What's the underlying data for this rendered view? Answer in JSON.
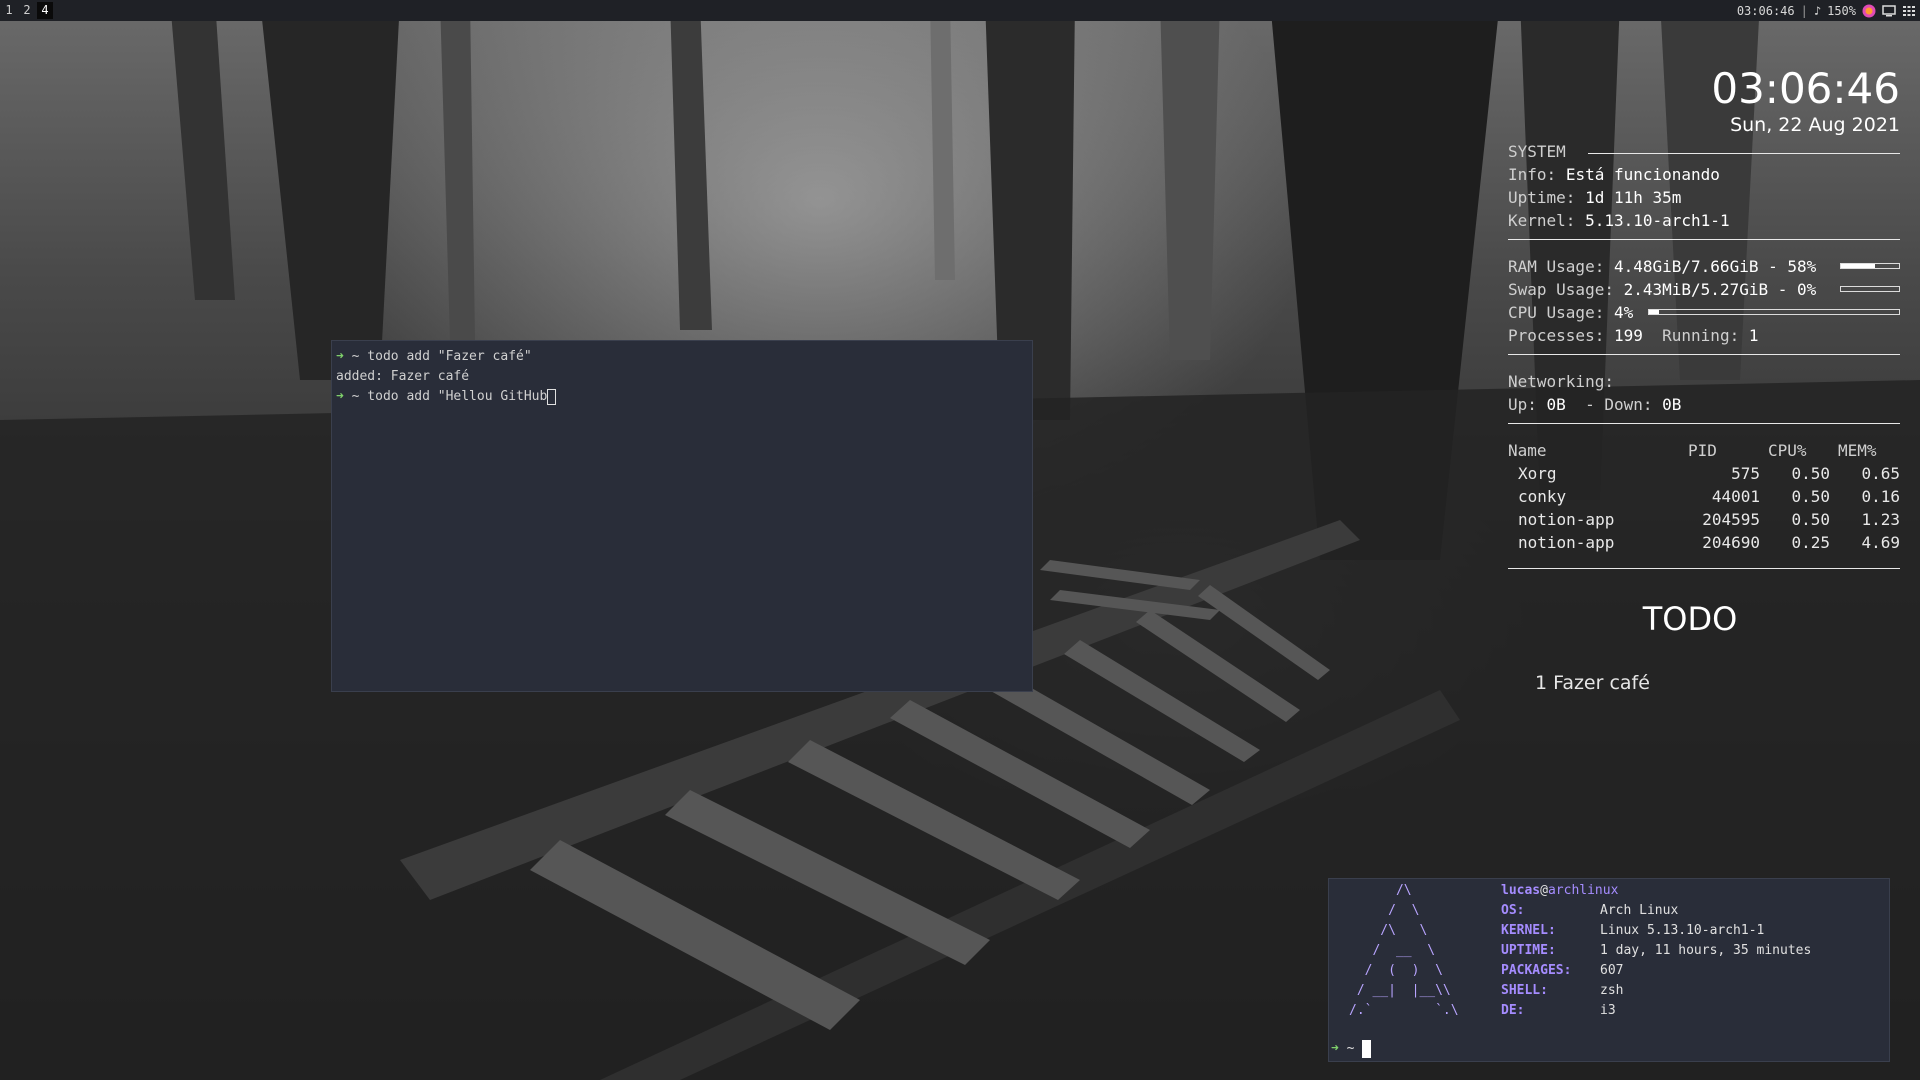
{
  "topbar": {
    "workspaces": [
      {
        "label": "1",
        "focused": false
      },
      {
        "label": "2",
        "focused": false
      },
      {
        "label": "4",
        "focused": true
      }
    ],
    "time": "03:06:46",
    "separator": "|",
    "volume": "150%",
    "icons": [
      "music-note-icon",
      "firefox-icon",
      "monitor-icon",
      "grid-icon"
    ]
  },
  "conky": {
    "clock": "03:06:46",
    "date": "Sun, 22 Aug 2021",
    "system_header": "SYSTEM",
    "info_label": "Info:",
    "info_value": "Está funcionando",
    "uptime_label": "Uptime:",
    "uptime_value": "1d 11h 35m",
    "kernel_label": "Kernel:",
    "kernel_value": "5.13.10-arch1-1",
    "ram_label": "RAM Usage:",
    "ram_value": "4.48GiB/7.66GiB - 58%",
    "ram_percent": 58,
    "swap_label": "Swap Usage:",
    "swap_value": "2.43MiB/5.27GiB - 0%",
    "swap_percent": 0,
    "cpu_label": "CPU Usage:",
    "cpu_value": "4%",
    "cpu_percent": 4,
    "processes_label": "Processes:",
    "processes_value": "199",
    "running_label": "Running:",
    "running_value": "1",
    "networking_label": "Networking:",
    "up_label": "Up:",
    "up_value": "0B",
    "down_label": "- Down:",
    "down_value": "0B",
    "proc_headers": {
      "name": "Name",
      "pid": "PID",
      "cpu": "CPU%",
      "mem": "MEM%"
    },
    "processes": [
      {
        "name": "Xorg",
        "pid": "575",
        "cpu": "0.50",
        "mem": "0.65"
      },
      {
        "name": "conky",
        "pid": "44001",
        "cpu": "0.50",
        "mem": "0.16"
      },
      {
        "name": "notion-app",
        "pid": "204595",
        "cpu": "0.50",
        "mem": "1.23"
      },
      {
        "name": "notion-app",
        "pid": "204690",
        "cpu": "0.25",
        "mem": "4.69"
      }
    ],
    "todo_title": "TODO",
    "todo_item": "1 Fazer café"
  },
  "terminal1": {
    "arrow": "➜",
    "line1": " ~ todo add \"Fazer café\"",
    "line2": "added: Fazer café",
    "line3": " ~ todo add \"Hellou GitHub"
  },
  "terminal2": {
    "ascii_art": "      /\\\n     /  \\\n    /\\   \\\n   /  __  \\\n  /  (  )  \\\n / __|  |__\\\\\n/.`        `.\\",
    "user": "lucas",
    "at": "@",
    "host": "archlinux",
    "fields": [
      {
        "key": "OS:",
        "value": "Arch Linux"
      },
      {
        "key": "KERNEL:",
        "value": "Linux 5.13.10-arch1-1"
      },
      {
        "key": "UPTIME:",
        "value": "1 day, 11 hours, 35 minutes"
      },
      {
        "key": "PACKAGES:",
        "value": "607"
      },
      {
        "key": "SHELL:",
        "value": "zsh"
      },
      {
        "key": "DE:",
        "value": "i3"
      }
    ],
    "arrow": "➜",
    "prompt": " ~ "
  }
}
